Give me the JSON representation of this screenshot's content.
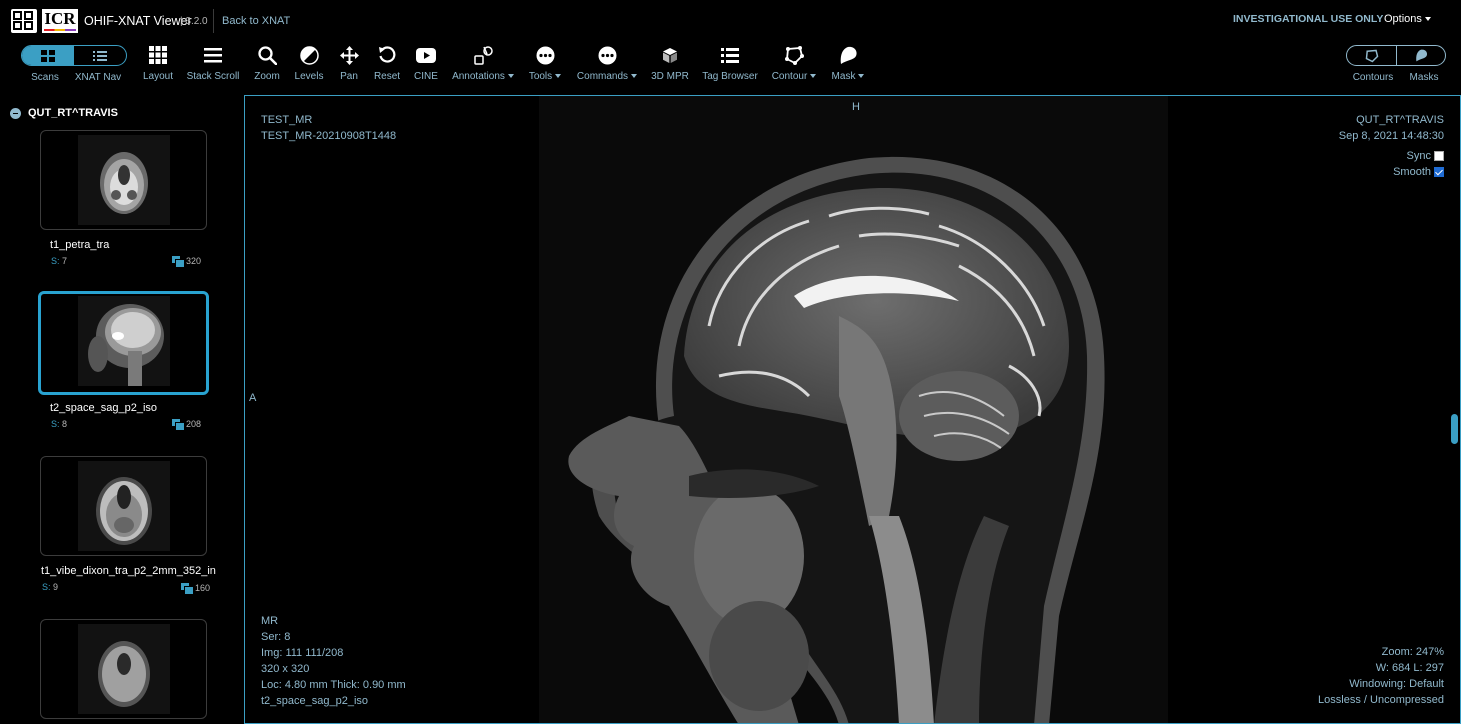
{
  "header": {
    "app_title": "OHIF-XNAT Viewer",
    "version": "| 3.2.0",
    "back_link": "Back to XNAT",
    "investigational": "INVESTIGATIONAL USE ONLY",
    "options_label": "Options",
    "logo_text": "ICR"
  },
  "toolbar": {
    "scans": "Scans",
    "xnat_nav": "XNAT Nav",
    "tools": [
      {
        "name": "layout",
        "label": "Layout",
        "icon": "grid-icon"
      },
      {
        "name": "stack-scroll",
        "label": "Stack Scroll",
        "icon": "bars-icon"
      },
      {
        "name": "zoom",
        "label": "Zoom",
        "icon": "search-icon"
      },
      {
        "name": "levels",
        "label": "Levels",
        "icon": "contrast-icon"
      },
      {
        "name": "pan",
        "label": "Pan",
        "icon": "arrows-icon"
      },
      {
        "name": "reset",
        "label": "Reset",
        "icon": "undo-icon"
      },
      {
        "name": "cine",
        "label": "CINE",
        "icon": "youtube-icon"
      },
      {
        "name": "annotations",
        "label": "Annotations",
        "icon": "shapes-icon"
      },
      {
        "name": "tools",
        "label": "Tools",
        "icon": "ellipsis-icon"
      },
      {
        "name": "commands",
        "label": "Commands",
        "icon": "ellipsis-icon"
      },
      {
        "name": "3d-mpr",
        "label": "3D MPR",
        "icon": "cube-icon"
      },
      {
        "name": "tag-browser",
        "label": "Tag Browser",
        "icon": "list-icon"
      },
      {
        "name": "contour",
        "label": "Contour",
        "icon": "polygon-icon"
      },
      {
        "name": "mask",
        "label": "Mask",
        "icon": "brush-icon"
      }
    ],
    "contours": "Contours",
    "masks": "Masks"
  },
  "sidebar": {
    "study_name": "QUT_RT^TRAVIS",
    "series_prefix": "S:",
    "series": [
      {
        "description": "t1_petra_tra",
        "number": "7",
        "count": "320"
      },
      {
        "description": "t2_space_sag_p2_iso",
        "number": "8",
        "count": "208",
        "selected": true
      },
      {
        "description": "t1_vibe_dixon_tra_p2_2mm_352_in",
        "number": "9",
        "count": "160"
      }
    ]
  },
  "viewport": {
    "top_left": {
      "line1": "TEST_MR",
      "line2": "TEST_MR-20210908T1448"
    },
    "top_right": {
      "patient": "QUT_RT^TRAVIS",
      "date": "Sep 8, 2021 14:48:30",
      "sync_label": "Sync",
      "smooth_label": "Smooth"
    },
    "orientation_top": "H",
    "orientation_left": "A",
    "bottom_left": {
      "modality": "MR",
      "series": "Ser: 8",
      "image": "Img: 111 111/208",
      "size": "320 x 320",
      "location": "Loc: 4.80 mm Thick: 0.90 mm",
      "description": "t2_space_sag_p2_iso"
    },
    "bottom_right": {
      "zoom": "Zoom: 247%",
      "wl": "W: 684 L: 297",
      "windowing": "Windowing: Default",
      "compression": "Lossless / Uncompressed"
    },
    "sync_checked": false,
    "smooth_checked": true
  },
  "colors": {
    "accent": "#3b9fc4",
    "text_dim": "#91b9cd",
    "selected_border": "#29a3d1"
  }
}
